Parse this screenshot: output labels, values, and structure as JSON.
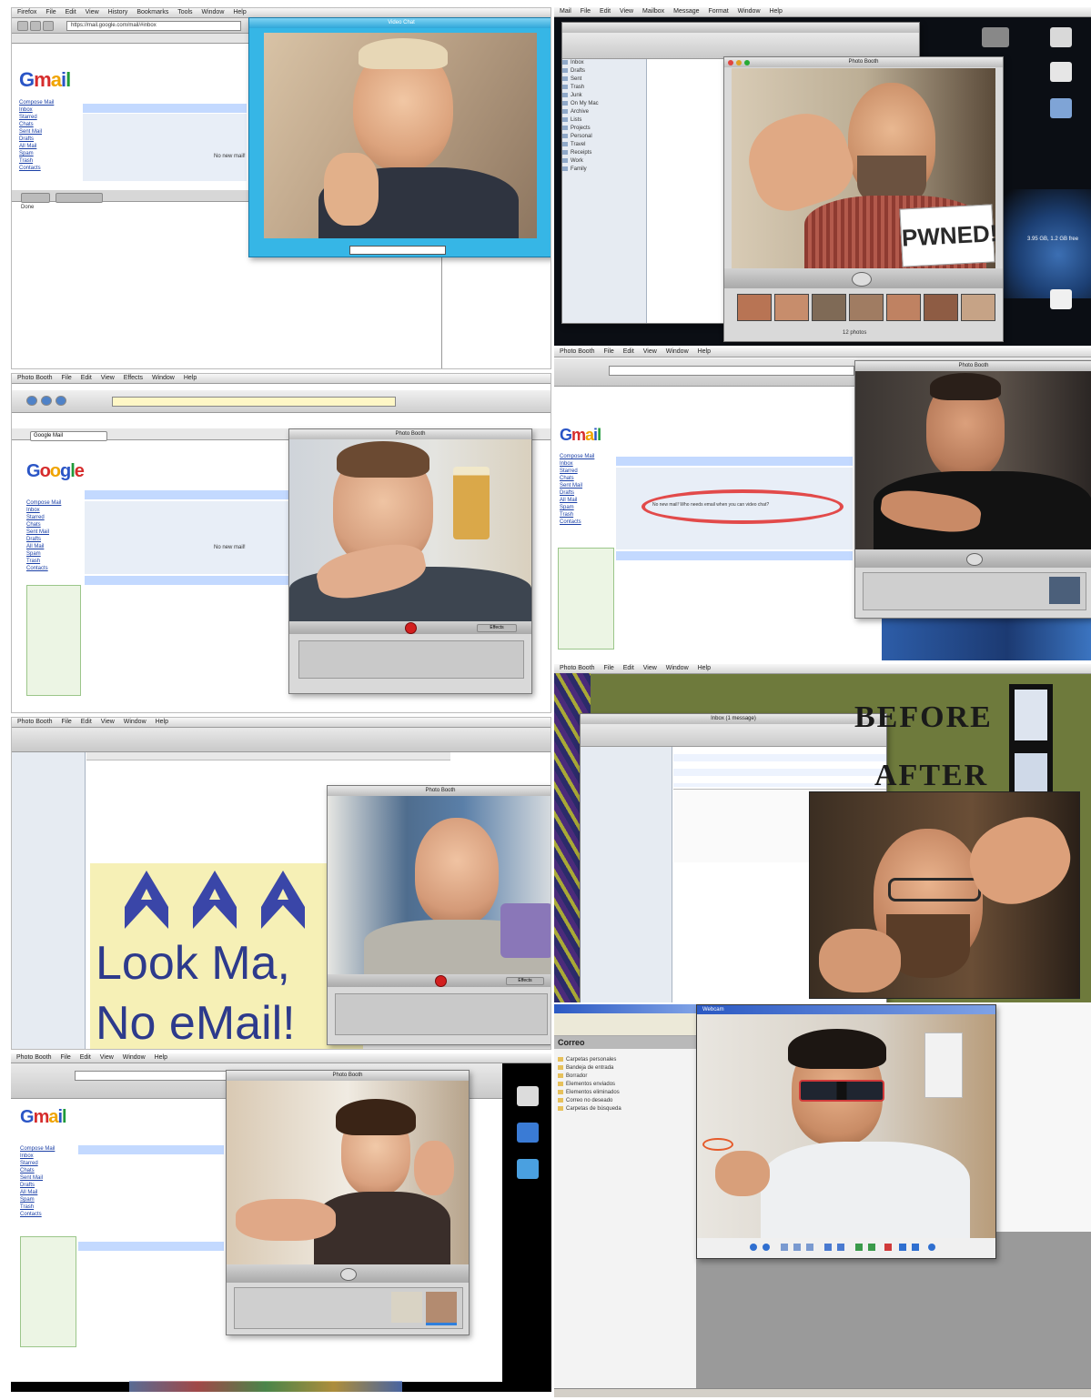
{
  "panel1": {
    "menu": [
      "Firefox",
      "File",
      "Edit",
      "View",
      "History",
      "Bookmarks",
      "Tools",
      "Window",
      "Help"
    ],
    "url": "https://mail.google.com/mail/#inbox",
    "logo_text": [
      "G",
      "m",
      "a",
      "i",
      "l"
    ],
    "links": [
      "Compose Mail",
      "Inbox",
      "Starred",
      "Chats",
      "Sent Mail",
      "Drafts",
      "All Mail",
      "Spam",
      "Trash",
      "Contacts"
    ],
    "empty_msg": "No new mail!",
    "window_title": "Video Chat",
    "status_text": "Done"
  },
  "panel2": {
    "menu": [
      "Mail",
      "File",
      "Edit",
      "View",
      "Mailbox",
      "Message",
      "Format",
      "Window",
      "Help"
    ],
    "window_title": "Photo Booth",
    "sign_text": "PWNED!",
    "desktop_label": "3.95 GB, 1.2 GB free",
    "folders": [
      "Inbox",
      "Drafts",
      "Sent",
      "Trash",
      "Junk",
      "On My Mac",
      "Archive",
      "Lists",
      "Projects",
      "Personal",
      "Travel",
      "Receipts",
      "Work",
      "Family"
    ],
    "thumb_count_label": "12 photos"
  },
  "panel3": {
    "menu": [
      "Photo Booth",
      "File",
      "Edit",
      "View",
      "Effects",
      "Window",
      "Help"
    ],
    "tab_title": "Google Mail",
    "logo_text": [
      "G",
      "o",
      "o",
      "g",
      "l",
      "e"
    ],
    "links": [
      "Compose Mail",
      "Inbox",
      "Starred",
      "Chats",
      "Sent Mail",
      "Drafts",
      "All Mail",
      "Spam",
      "Trash",
      "Contacts"
    ],
    "empty_msg": "No new mail!",
    "window_title": "Photo Booth",
    "effects_label": "Effects"
  },
  "panel4": {
    "menu": [
      "Photo Booth",
      "File",
      "Edit",
      "View",
      "Window",
      "Help"
    ],
    "logo_text": [
      "G",
      "m",
      "a",
      "i",
      "l"
    ],
    "links": [
      "Compose Mail",
      "Inbox",
      "Starred",
      "Chats",
      "Sent Mail",
      "Drafts",
      "All Mail",
      "Spam",
      "Trash",
      "Contacts"
    ],
    "circled_msg": "No new mail! Who needs email when you can video chat?",
    "window_title": "Photo Booth"
  },
  "panel5": {
    "menu": [
      "Photo Booth",
      "File",
      "Edit",
      "View",
      "Window",
      "Help"
    ],
    "window_title": "Photo Booth",
    "headline_line1": "Look Ma,",
    "headline_line2": "No eMail!",
    "effects_label": "Effects"
  },
  "panel6": {
    "menu": [
      "Photo Booth",
      "File",
      "Edit",
      "View",
      "Window",
      "Help"
    ],
    "window_title": "Inbox (1 message)",
    "before_label": "BEFORE",
    "after_label": "AFTER"
  },
  "panel7": {
    "menu": [
      "Photo Booth",
      "File",
      "Edit",
      "View",
      "Window",
      "Help"
    ],
    "logo_text": [
      "G",
      "m",
      "a",
      "i",
      "l"
    ],
    "links": [
      "Compose Mail",
      "Inbox",
      "Starred",
      "Chats",
      "Sent Mail",
      "Drafts",
      "All Mail",
      "Spam",
      "Trash",
      "Contacts"
    ],
    "window_title": "Photo Booth"
  },
  "panel8": {
    "left_title": "Correo",
    "window_title": "Webcam",
    "folders": [
      "Carpetas personales",
      "Bandeja de entrada",
      "Borrador",
      "Elementos enviados",
      "Elementos eliminados",
      "Correo no deseado",
      "Carpetas de búsqueda"
    ]
  }
}
